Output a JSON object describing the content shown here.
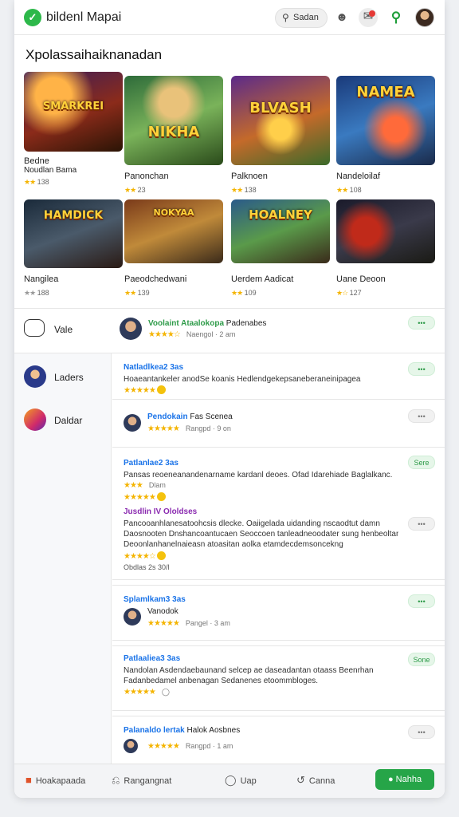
{
  "header": {
    "app_title": "bildenl Mapai",
    "search_label": "Sadan",
    "icons": [
      "leaf-logo-icon",
      "search-icon",
      "user-icon",
      "bell-icon",
      "search-icon",
      "avatar"
    ]
  },
  "section": {
    "title": "Xpolassaihaiknanadan"
  },
  "games": [
    {
      "name": "Bedne",
      "sub": "Noudlan Bama",
      "rating": "138",
      "word": "SMARKREI"
    },
    {
      "name": "Panonchan",
      "sub": "",
      "rating": "23",
      "word": "NIKHA"
    },
    {
      "name": "Palknoen",
      "sub": "",
      "rating": "138",
      "word": "BLVASH"
    },
    {
      "name": "Nandeloilaf",
      "sub": "",
      "rating": "108",
      "word": "NAMEA"
    },
    {
      "name": "Nangilea",
      "sub": "",
      "rating": "188",
      "word": "HAMDICK"
    },
    {
      "name": "Paeodchedwani",
      "sub": "",
      "rating": "139",
      "word": "NOKYAA"
    },
    {
      "name": "Uerdem Aadicat",
      "sub": "",
      "rating": "109",
      "word": "HOALNEY"
    },
    {
      "name": "Uane Deoon",
      "sub": "",
      "rating": "127",
      "word": ""
    }
  ],
  "sidebar": {
    "items": [
      {
        "label": "Vale"
      },
      {
        "label": "Laders"
      },
      {
        "label": "Daldar"
      }
    ]
  },
  "featured": {
    "user": "Voolaint Ataalokopa",
    "suffix": "Padenabes",
    "meta": "Naengol · 2 am",
    "action": "•••"
  },
  "cards": [
    {
      "title": "Natladlkea2 3as",
      "text": [
        "Hoaeantankeler anodSe koanis Hedlendgekepsaneberaneinipagea"
      ],
      "action": "•••",
      "meta": ""
    },
    {
      "title": "Pendokain",
      "title_suffix": "Fas Scenea",
      "text": [],
      "action": "•••",
      "meta": "Rangpd · 9 on"
    },
    {
      "title": "Patlanlae2 3as",
      "text": [
        "Pansas reoeneanandenarname kardanl deoes. Ofad Idarehiade Baglalkanc."
      ],
      "action": "Sere",
      "meta": "Dlam",
      "sub_title": "Jusdlin IV Ololdses",
      "sub_text": [
        "Pancooanhlanesatoohcsis dlecke. Oaiigelada uidanding nscaodtut damn",
        "Daosnooten Dnshancoantucaen Seoccoen tanleadneoodater sung henbeoltang",
        "Deoonlanhanelnaieasn atoasitan aolka etamdecdemsoncekng"
      ],
      "sub_action": "•••",
      "footer": "Obdlas 2s 30/l"
    },
    {
      "title": "Splamlkam3 3as",
      "text": [],
      "user": "Vanodok",
      "action": "•••",
      "meta": "Pangel · 3 am"
    },
    {
      "title": "Patlaaliea3 3as",
      "text": [
        "Nandolan Asdendaebaunand selcep ae daseadantan otaass Beenrhan",
        "Fadanbedamel anbenagan Sedanenes etoommbloges."
      ],
      "action": "Sone",
      "meta": ""
    },
    {
      "title": "Palanaldo lertak",
      "title_suffix": "Halok Aosbnes",
      "text": [],
      "action": "•••",
      "meta": "Rangpd · 1 am"
    }
  ],
  "bottom_nav": {
    "items": [
      {
        "label": "Hoakapaada",
        "icon": "gamepad-icon"
      },
      {
        "label": "Rangangnat",
        "icon": "controller-icon"
      },
      {
        "label": "Uap",
        "icon": "chat-icon"
      },
      {
        "label": "Canna",
        "icon": "share-icon"
      }
    ],
    "cta": "Nahha"
  },
  "colors": {
    "accent": "#26a548",
    "link": "#1a73e8",
    "star": "#f4b400"
  }
}
